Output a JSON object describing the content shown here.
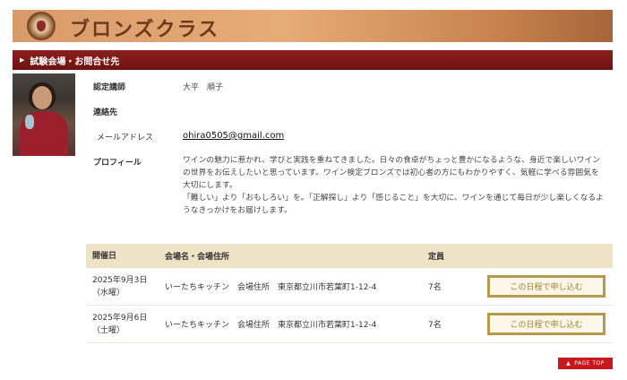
{
  "header": {
    "title": "ブロンズクラス"
  },
  "section": {
    "title": "試験会場・お問合せ先"
  },
  "instructor": {
    "label": "認定講師",
    "name": "大平　順子"
  },
  "contact": {
    "label": "連絡先",
    "email_label": "メールアドレス",
    "email": "ohira0505@gmail.com"
  },
  "profile": {
    "label": "プロフィール",
    "lines": [
      "ワインの魅力に惹かれ、学びと実践を重ねてきました。日々の食卓がちょっと豊かになるような、身近で楽しいワインの世界をお伝えしたいと思っています。ワイン検定ブロンズでは初心者の方にもわかりやすく、気軽に学べる雰囲気を大切にします。",
      "「難しい」より「おもしろい」を。「正解探し」より「感じること」を大切に、ワインを通じて毎日が少し楽しくなるようなきっかけをお届けします。"
    ]
  },
  "schedule": {
    "headers": {
      "date": "開催日",
      "venue": "会場名・会場住所",
      "capacity": "定員",
      "action": ""
    },
    "rows": [
      {
        "date": "2025年9月3日",
        "weekday": "（水曜）",
        "venue": "いーたちキッチン　会場住所　東京都立川市若葉町1-12-4",
        "capacity": "7名",
        "button": "この日程で申し込む"
      },
      {
        "date": "2025年9月6日",
        "weekday": "（土曜）",
        "venue": "いーたちキッチン　会場住所　東京都立川市若葉町1-12-4",
        "capacity": "7名",
        "button": "この日程で申し込む"
      }
    ]
  },
  "page_top": {
    "label": "PAGE TOP",
    "icon": "triangle-up-icon"
  },
  "colors": {
    "section_bar": "#7a1818",
    "table_header": "#efe3c6",
    "button_border": "#b59a4e",
    "page_top": "#c8181e"
  }
}
